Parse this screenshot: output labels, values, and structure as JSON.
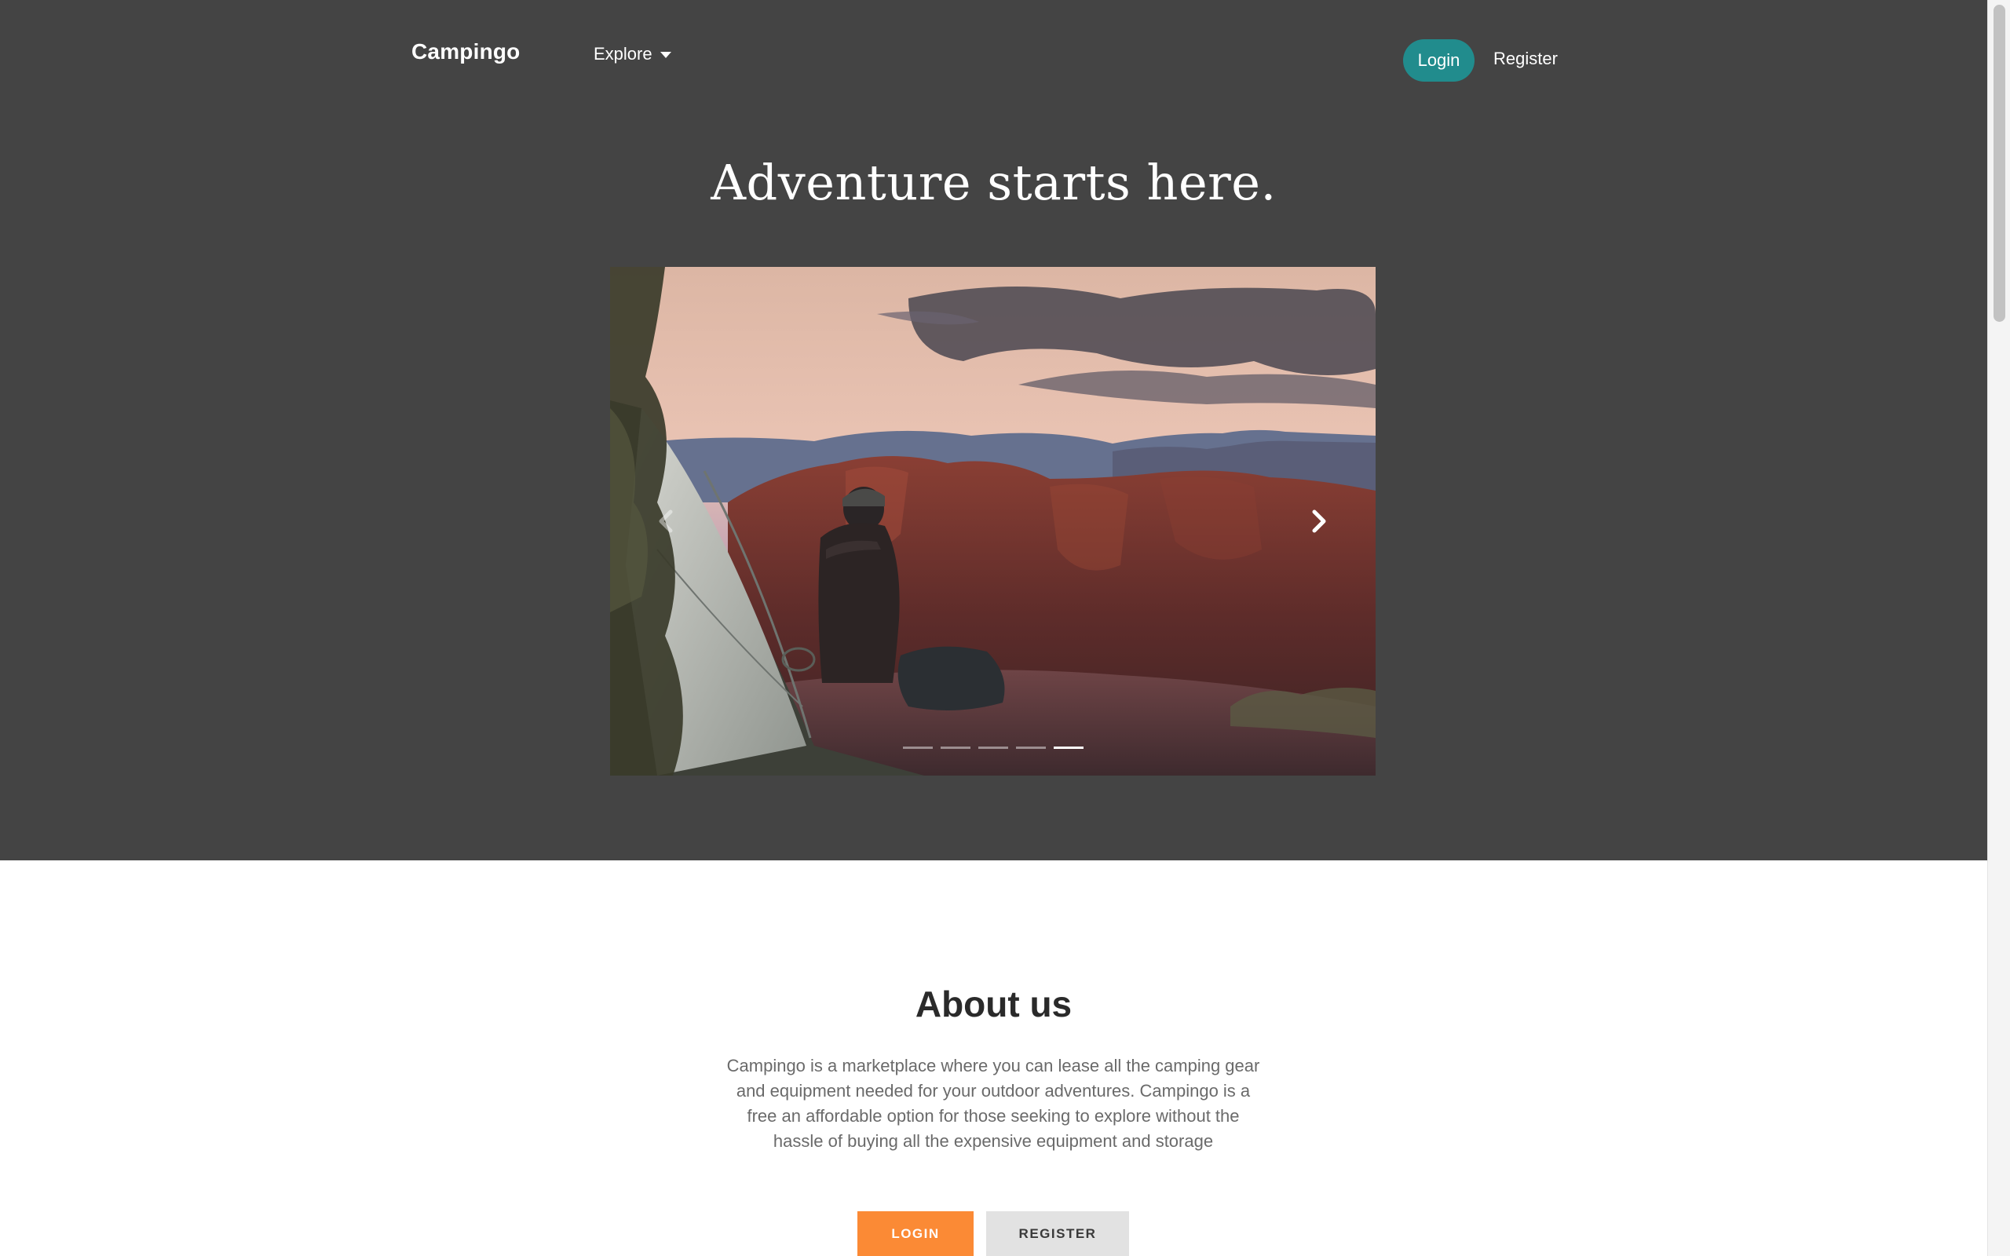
{
  "navbar": {
    "brand": "Campingo",
    "explore_label": "Explore",
    "login_label": "Login",
    "register_label": "Register"
  },
  "hero": {
    "title": "Adventure starts here."
  },
  "carousel": {
    "slide_count": 5,
    "active_index": 4
  },
  "about": {
    "title": "About us",
    "text": "Campingo is a marketplace where you can lease all the camping gear and equipment needed for your outdoor adventures. Campingo is a free an affordable option for those seeking to explore without the hassle of buying all the expensive equipment and storage",
    "login_button": "LOGIN",
    "register_button": "REGISTER"
  },
  "colors": {
    "hero_background": "#444444",
    "nav_login_background": "#218c8d",
    "login_button_background": "#fb8a35",
    "register_button_background": "#e2e2e2"
  },
  "icons": {
    "explore_caret": "caret-down-icon",
    "carousel_prev": "chevron-left-icon",
    "carousel_next": "chevron-right-icon"
  }
}
